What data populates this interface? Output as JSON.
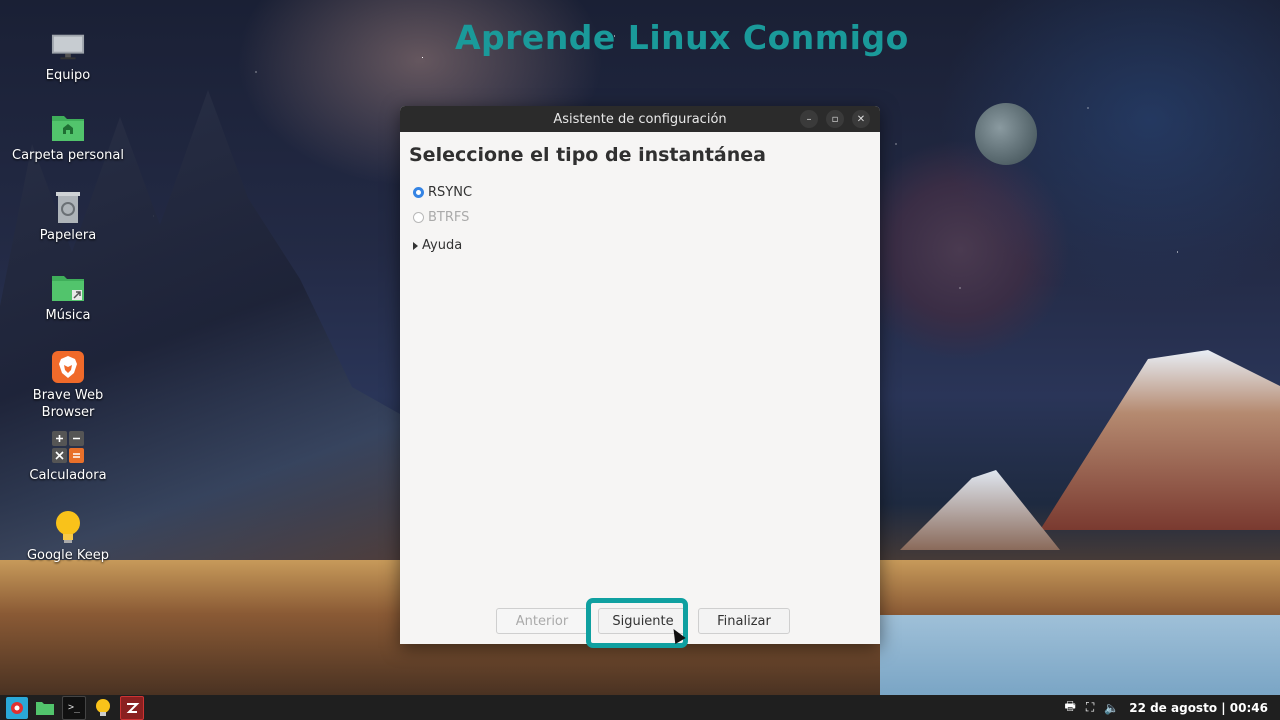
{
  "watermark": "Aprende Linux Conmigo",
  "desktop": {
    "icons": [
      {
        "label": "Equipo",
        "icon": "computer-icon"
      },
      {
        "label": "Carpeta personal",
        "icon": "home-folder-icon"
      },
      {
        "label": "Papelera",
        "icon": "trash-icon"
      },
      {
        "label": "Música",
        "icon": "music-folder-icon"
      },
      {
        "label": "Brave Web Browser",
        "icon": "brave-icon"
      },
      {
        "label": "Calculadora",
        "icon": "calculator-icon"
      },
      {
        "label": "Google Keep",
        "icon": "keep-icon"
      }
    ]
  },
  "window": {
    "title": "Asistente de configuración",
    "heading": "Seleccione el tipo de instantánea",
    "options": [
      {
        "label": "RSYNC",
        "selected": true,
        "enabled": true
      },
      {
        "label": "BTRFS",
        "selected": false,
        "enabled": false
      }
    ],
    "expander": "Ayuda",
    "buttons": {
      "previous": "Anterior",
      "next": "Siguiente",
      "finish": "Finalizar"
    }
  },
  "taskbar": {
    "clock": "22 de agosto | 00:46"
  },
  "colors": {
    "accent": "#0fa0a0",
    "radio": "#3584e4",
    "titlebar": "#2b2b2b"
  }
}
